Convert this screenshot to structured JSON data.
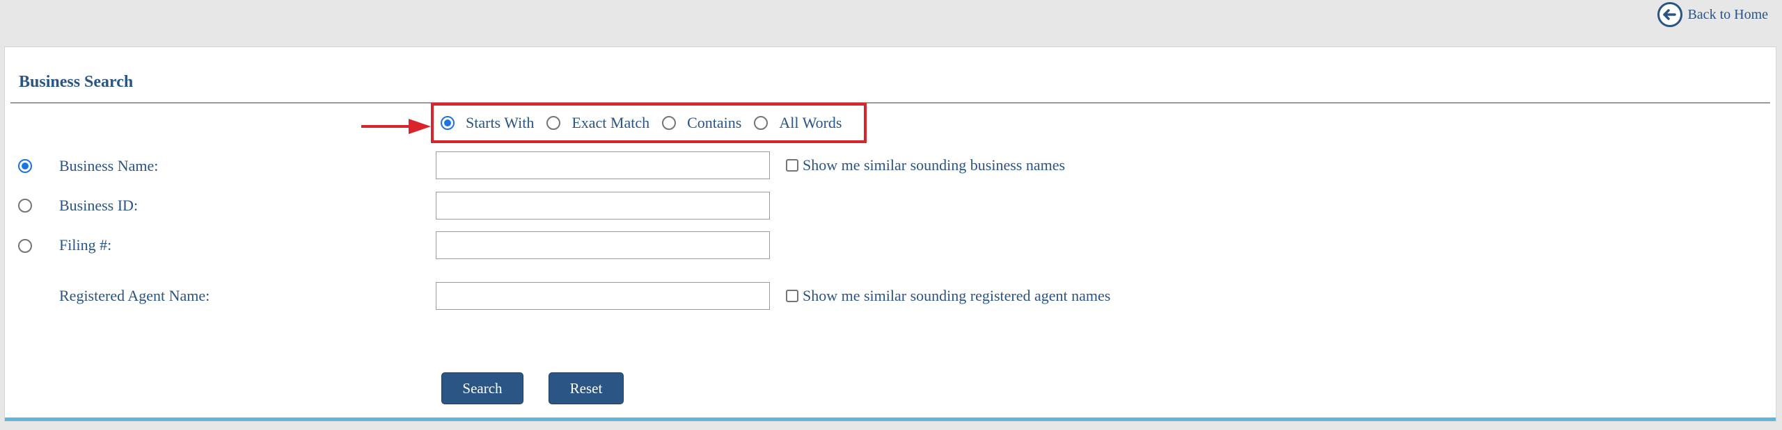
{
  "header": {
    "back_label": "Back to Home",
    "back_icon": "arrow-left-circle-icon"
  },
  "form": {
    "title": "Business Search",
    "match_options": [
      {
        "label": "Starts With",
        "selected": true
      },
      {
        "label": "Exact Match",
        "selected": false
      },
      {
        "label": "Contains",
        "selected": false
      },
      {
        "label": "All Words",
        "selected": false
      }
    ],
    "fields": {
      "business_name": {
        "label": "Business Name:",
        "value": "",
        "selected": true
      },
      "business_id": {
        "label": "Business ID:",
        "value": "",
        "selected": false
      },
      "filing_number": {
        "label": "Filing #:",
        "value": "",
        "selected": false
      },
      "registered_agent": {
        "label": "Registered Agent Name:",
        "value": ""
      }
    },
    "similar_business_label": "Show me similar sounding business names",
    "similar_agent_label": "Show me similar sounding registered agent names",
    "search_label": "Search",
    "reset_label": "Reset"
  },
  "colors": {
    "primary": "#2a5485",
    "button": "#2b5585",
    "highlight": "#d9242b",
    "accent_bar": "#5fb6d8",
    "radio_selected": "#1b74e4"
  }
}
